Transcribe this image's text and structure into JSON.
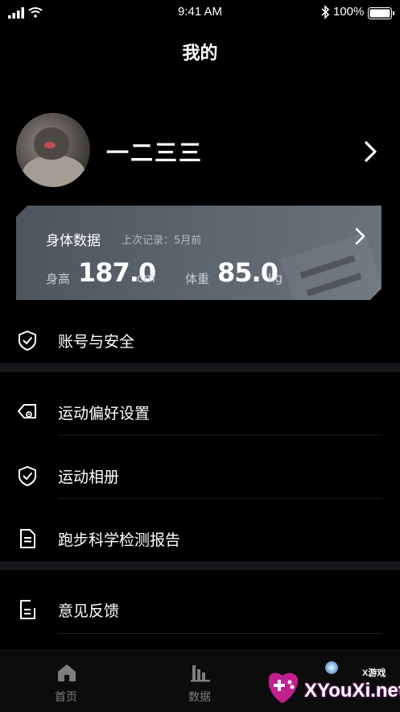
{
  "status_bar": {
    "time": "9:41 AM",
    "battery": "100%"
  },
  "header": {
    "title": "我的"
  },
  "profile": {
    "name": "一二三三"
  },
  "body_data": {
    "title": "身体数据",
    "last_record": "上次记录：5月前",
    "height_label": "身高",
    "height_value": "187.0",
    "height_unit": "cm",
    "weight_label": "体重",
    "weight_value": "85.0",
    "weight_unit": "kg"
  },
  "menu": {
    "account_security": "账号与安全",
    "sport_preferences": "运动偏好设置",
    "sport_album": "运动相册",
    "running_report": "跑步科学检测报告",
    "feedback": "意见反馈"
  },
  "tab_bar": {
    "home": "首页",
    "data": "数据"
  },
  "watermark": {
    "small": "X游戏",
    "text": "XYouXi.net"
  },
  "colors": {
    "background": "#000000",
    "card": "#5a626c",
    "separator": "#16171a"
  }
}
